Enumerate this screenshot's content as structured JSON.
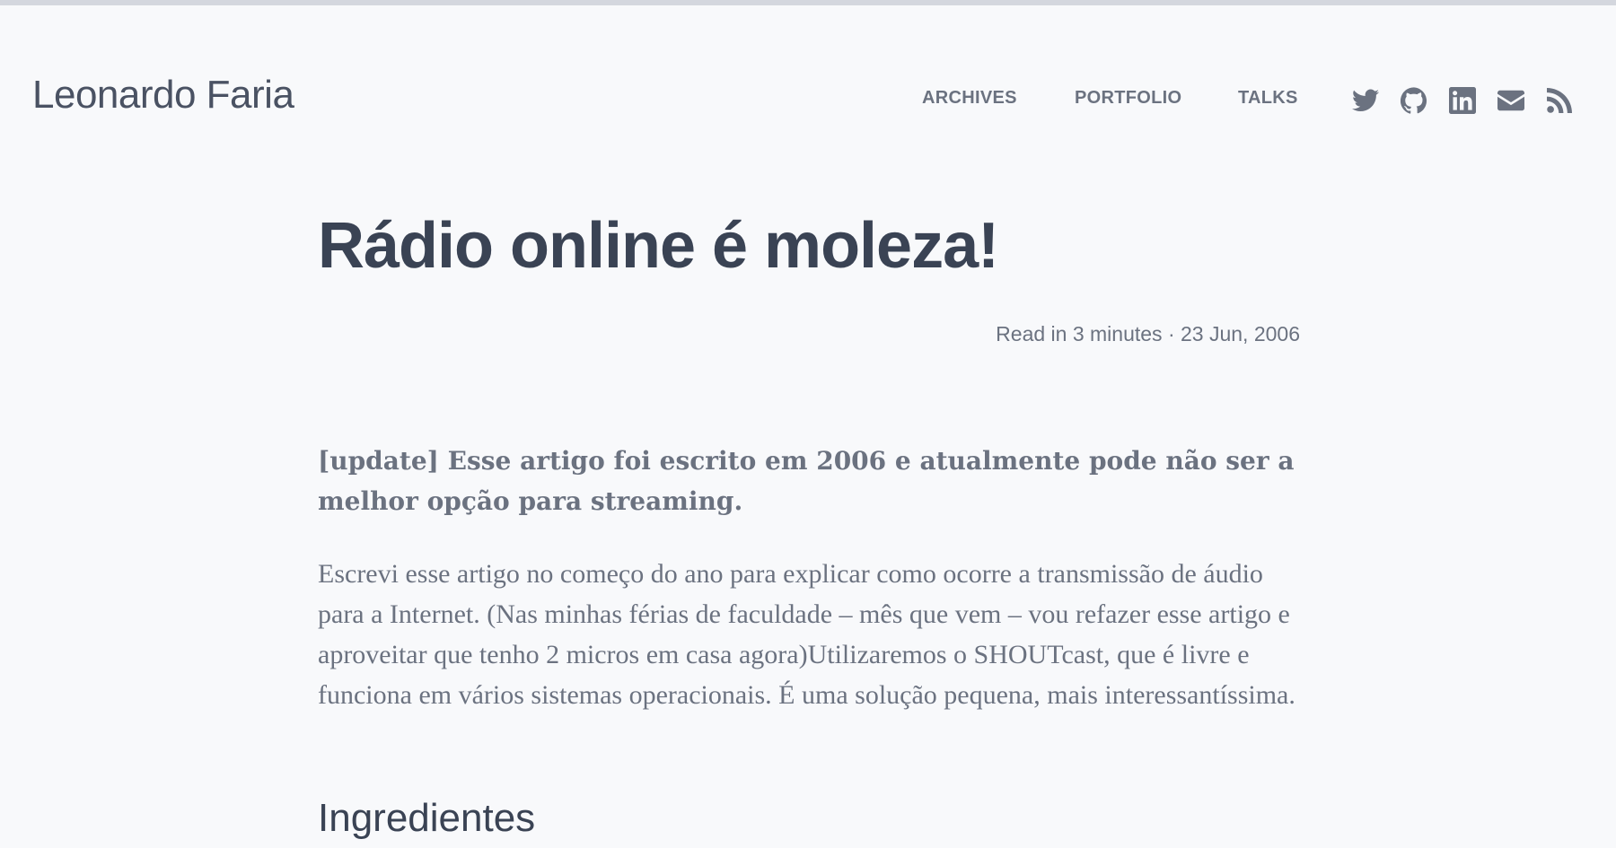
{
  "site": {
    "title": "Leonardo Faria"
  },
  "nav": {
    "items": [
      {
        "label": "ARCHIVES"
      },
      {
        "label": "PORTFOLIO"
      },
      {
        "label": "TALKS"
      }
    ]
  },
  "social": {
    "icons": [
      "twitter-icon",
      "github-icon",
      "linkedin-icon",
      "email-icon",
      "rss-icon"
    ],
    "color": "#6b7280"
  },
  "post": {
    "title": "Rádio online é moleza!",
    "meta": "Read in 3 minutes · 23 Jun, 2006",
    "update_note": "[update] Esse artigo foi escrito em 2006 e atualmente pode não ser a melhor opção para streaming.",
    "paragraph": "Escrevi esse artigo no começo do ano para explicar como ocorre a transmissão de áudio para a Internet. (Nas minhas férias de faculdade – mês que vem – vou refazer esse artigo e aproveitar que tenho 2 micros em casa agora)Utilizaremos o SHOUTcast, que é livre e funciona em vários sistemas operacionais. É uma solução pequena, mais interessantíssima.",
    "section_heading": "Ingredientes"
  },
  "colors": {
    "background": "#f8f9fb",
    "heading": "#3a4354",
    "muted": "#6b7280",
    "top_bar": "#d4d7de"
  }
}
